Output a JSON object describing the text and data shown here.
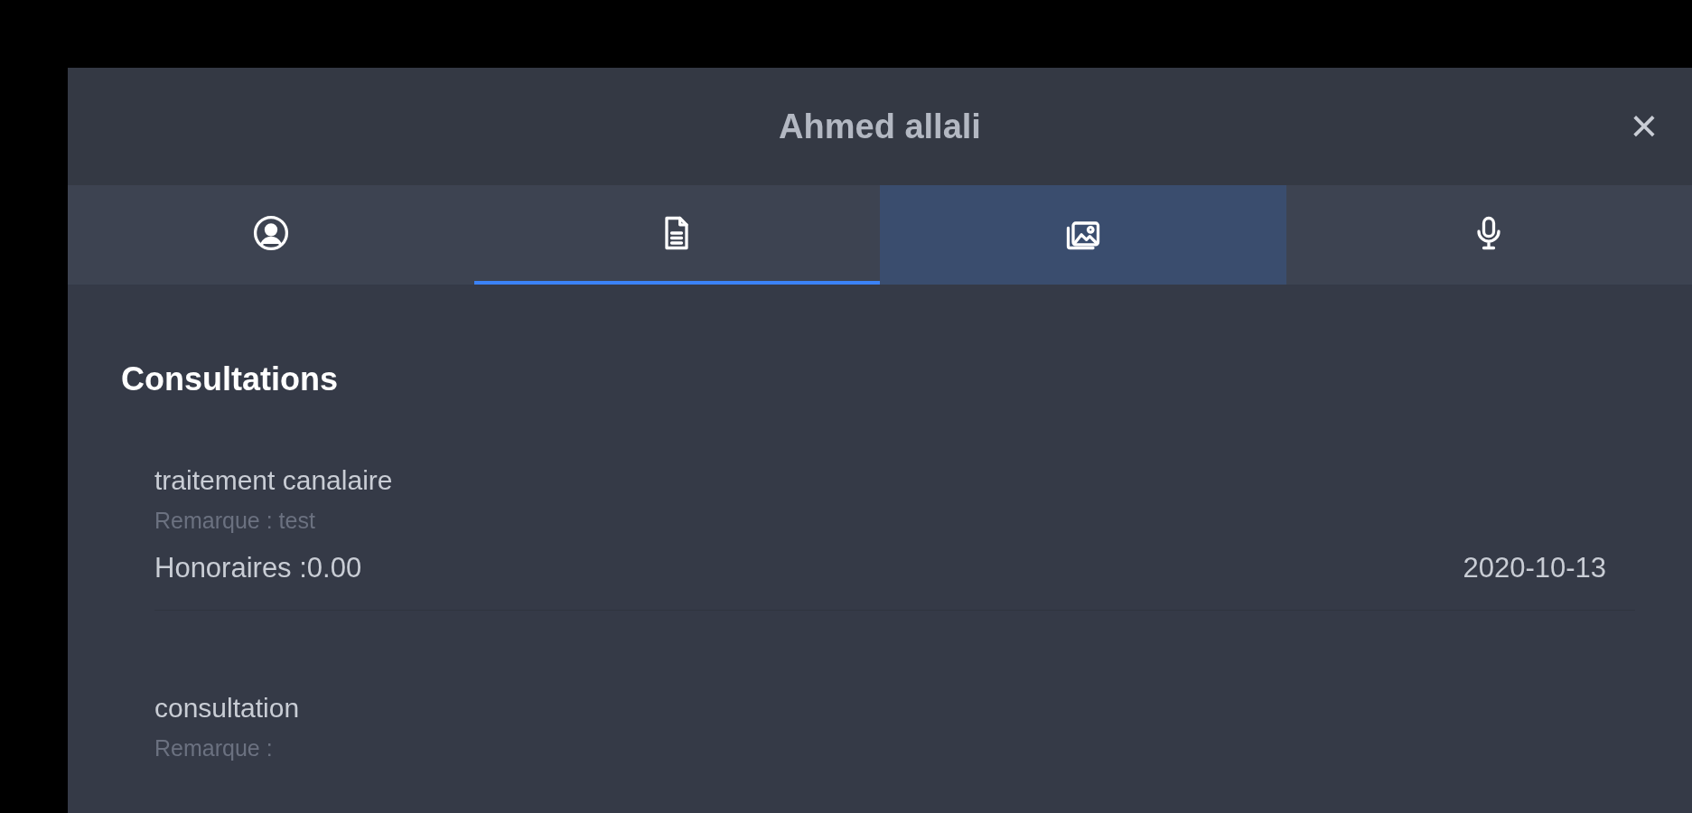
{
  "dialog": {
    "title": "Ahmed allali",
    "close": "×"
  },
  "tabs": [
    {
      "selected": false,
      "highlighted": false
    },
    {
      "selected": true,
      "highlighted": false
    },
    {
      "selected": false,
      "highlighted": true
    },
    {
      "selected": false,
      "highlighted": false
    }
  ],
  "section": {
    "heading": "Consultations"
  },
  "consultations": [
    {
      "title": "traitement canalaire",
      "remark": "Remarque : test",
      "fee": "Honoraires :0.00",
      "date": "2020-10-13"
    },
    {
      "title": "consultation",
      "remark": "Remarque :"
    }
  ]
}
